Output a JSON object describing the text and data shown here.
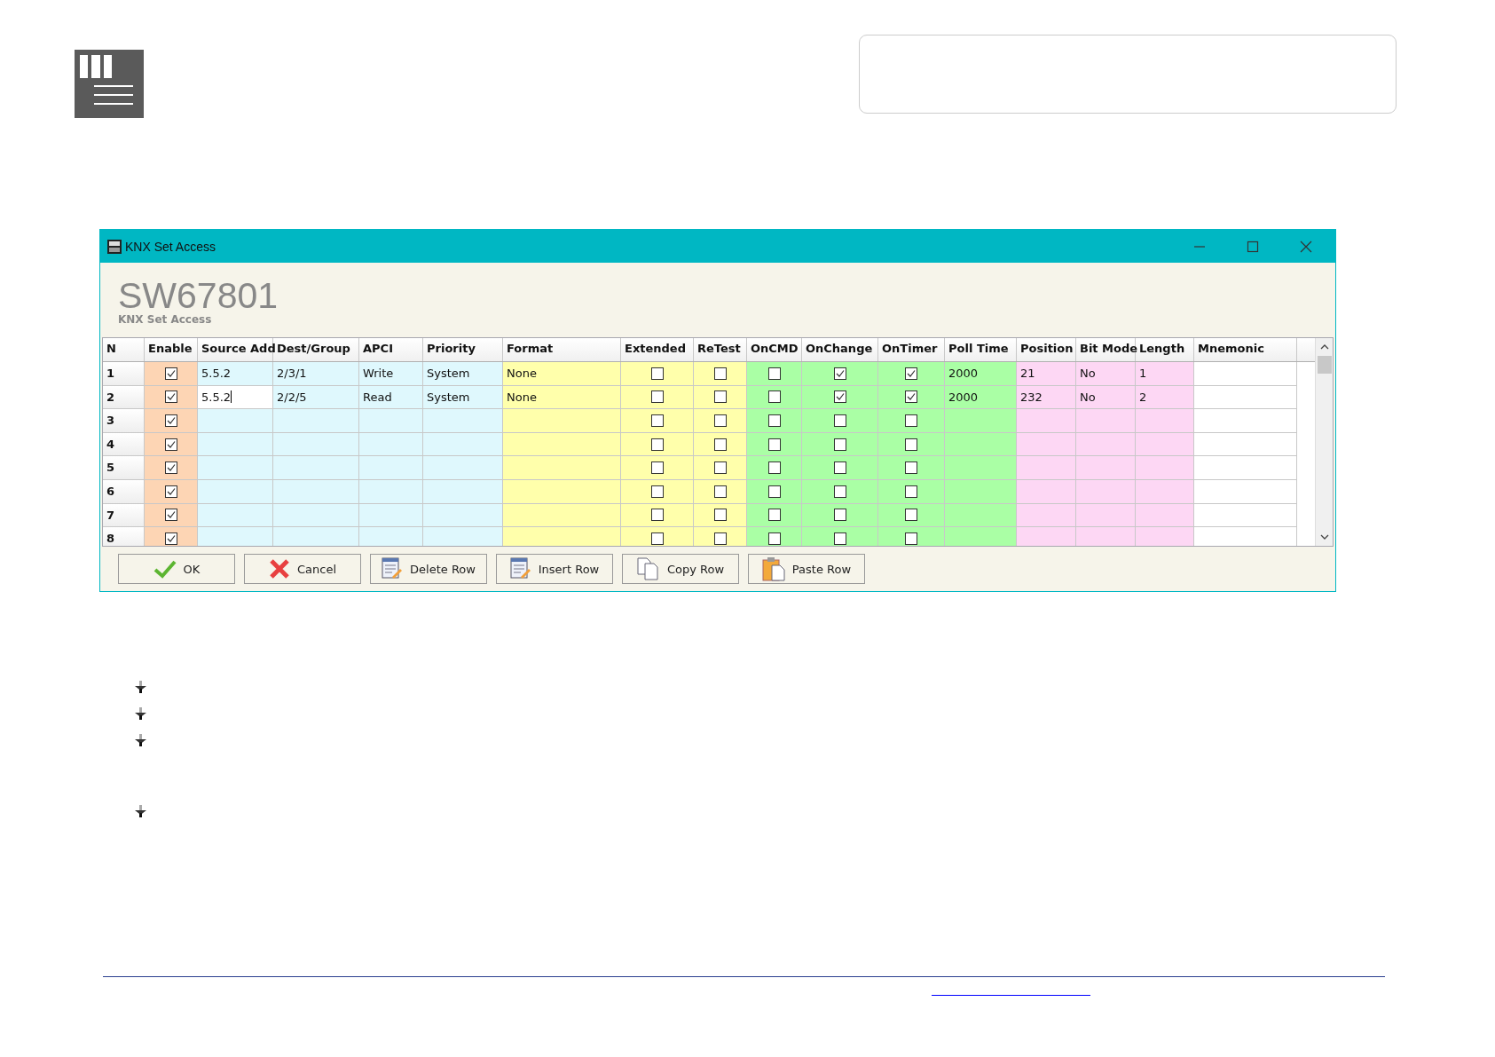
{
  "window": {
    "title": "KNX Set Access"
  },
  "heading": {
    "code": "SW67801",
    "subtitle": "KNX Set Access"
  },
  "table": {
    "columns": [
      {
        "label": "N",
        "kind": "index"
      },
      {
        "label": "Enable",
        "kind": "check",
        "color": "#fdd5b4"
      },
      {
        "label": "Source Add",
        "kind": "text",
        "color": "#dff8fd"
      },
      {
        "label": "Dest/Group",
        "kind": "text",
        "color": "#dff8fd"
      },
      {
        "label": "APCI",
        "kind": "text",
        "color": "#dff8fd"
      },
      {
        "label": "Priority",
        "kind": "text",
        "color": "#dff8fd"
      },
      {
        "label": "Format",
        "kind": "text",
        "color": "#ffffab"
      },
      {
        "label": "Extended",
        "kind": "check",
        "color": "#ffffab"
      },
      {
        "label": "ReTest",
        "kind": "check",
        "color": "#ffffab"
      },
      {
        "label": "OnCMD",
        "kind": "check",
        "color": "#aaffa5"
      },
      {
        "label": "OnChange",
        "kind": "check",
        "color": "#aaffa5"
      },
      {
        "label": "OnTimer",
        "kind": "check",
        "color": "#aaffa5"
      },
      {
        "label": "Poll Time",
        "kind": "text",
        "color": "#aaffa5"
      },
      {
        "label": "Position",
        "kind": "text",
        "color": "#fdd7f4"
      },
      {
        "label": "Bit Mode",
        "kind": "text",
        "color": "#fdd7f4"
      },
      {
        "label": "Length",
        "kind": "text",
        "color": "#fdd7f4"
      },
      {
        "label": "Mnemonic",
        "kind": "text",
        "color": "#ffffff"
      }
    ],
    "rows": [
      {
        "cells": [
          {
            "text": "1"
          },
          {
            "checked": true
          },
          {
            "text": "5.5.2"
          },
          {
            "text": "2/3/1"
          },
          {
            "text": "Write"
          },
          {
            "text": "System"
          },
          {
            "text": "None"
          },
          {
            "checked": false
          },
          {
            "checked": false
          },
          {
            "checked": false
          },
          {
            "checked": true
          },
          {
            "checked": true
          },
          {
            "text": "2000"
          },
          {
            "text": "21"
          },
          {
            "text": "No"
          },
          {
            "text": "1"
          },
          {}
        ]
      },
      {
        "cells": [
          {
            "text": "2"
          },
          {
            "checked": true
          },
          {
            "text": "5.5.2",
            "focused": true
          },
          {
            "text": "2/2/5"
          },
          {
            "text": "Read"
          },
          {
            "text": "System"
          },
          {
            "text": "None"
          },
          {
            "checked": false
          },
          {
            "checked": false
          },
          {
            "checked": false
          },
          {
            "checked": true
          },
          {
            "checked": true
          },
          {
            "text": "2000"
          },
          {
            "text": "232"
          },
          {
            "text": "No"
          },
          {
            "text": "2"
          },
          {}
        ]
      },
      {
        "cells": [
          {
            "text": "3"
          },
          {
            "checked": true
          },
          {},
          {},
          {},
          {},
          {},
          {
            "checked": false
          },
          {
            "checked": false
          },
          {
            "checked": false
          },
          {
            "checked": false
          },
          {
            "checked": false
          },
          {},
          {},
          {},
          {},
          {}
        ]
      },
      {
        "cells": [
          {
            "text": "4"
          },
          {
            "checked": true
          },
          {},
          {},
          {},
          {},
          {},
          {
            "checked": false
          },
          {
            "checked": false
          },
          {
            "checked": false
          },
          {
            "checked": false
          },
          {
            "checked": false
          },
          {},
          {},
          {},
          {},
          {}
        ]
      },
      {
        "cells": [
          {
            "text": "5"
          },
          {
            "checked": true
          },
          {},
          {},
          {},
          {},
          {},
          {
            "checked": false
          },
          {
            "checked": false
          },
          {
            "checked": false
          },
          {
            "checked": false
          },
          {
            "checked": false
          },
          {},
          {},
          {},
          {},
          {}
        ]
      },
      {
        "cells": [
          {
            "text": "6"
          },
          {
            "checked": true
          },
          {},
          {},
          {},
          {},
          {},
          {
            "checked": false
          },
          {
            "checked": false
          },
          {
            "checked": false
          },
          {
            "checked": false
          },
          {
            "checked": false
          },
          {},
          {},
          {},
          {},
          {}
        ]
      },
      {
        "cells": [
          {
            "text": "7"
          },
          {
            "checked": true
          },
          {},
          {},
          {},
          {},
          {},
          {
            "checked": false
          },
          {
            "checked": false
          },
          {
            "checked": false
          },
          {
            "checked": false
          },
          {
            "checked": false
          },
          {},
          {},
          {},
          {},
          {}
        ]
      },
      {
        "cells": [
          {
            "text": "8"
          },
          {
            "checked": true
          },
          {},
          {},
          {},
          {},
          {},
          {
            "checked": false
          },
          {
            "checked": false
          },
          {
            "checked": false
          },
          {
            "checked": false
          },
          {
            "checked": false
          },
          {},
          {},
          {},
          {},
          {}
        ]
      }
    ]
  },
  "buttons": [
    {
      "label": "OK",
      "kind": "ok"
    },
    {
      "label": "Cancel",
      "kind": "cancel"
    },
    {
      "label": "Delete Row",
      "kind": "delete"
    },
    {
      "label": "Insert Row",
      "kind": "insert"
    },
    {
      "label": "Copy Row",
      "kind": "copy"
    },
    {
      "label": "Paste Row",
      "kind": "paste"
    }
  ]
}
